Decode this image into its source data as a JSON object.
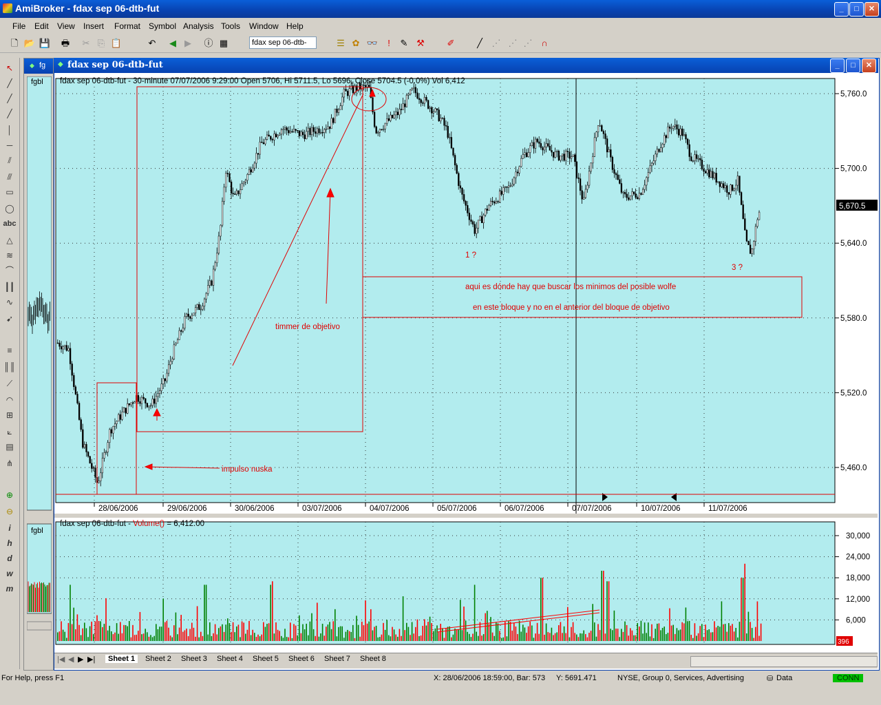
{
  "app": {
    "title": "AmiBroker - fdax sep 06-dtb-fut",
    "minimize": "_",
    "maximize": "□",
    "close": "✕"
  },
  "menu": [
    "File",
    "Edit",
    "View",
    "Insert",
    "Format",
    "Symbol",
    "Analysis",
    "Tools",
    "Window",
    "Help"
  ],
  "toolbar": {
    "symbol_select": "fdax sep 06-dtb-"
  },
  "child_window": {
    "title": "fdax sep 06-dtb-fut",
    "side_label": "fgbl",
    "side_tab": "fg"
  },
  "price_pane": {
    "header": "fdax sep 06-dtb-fut - 30-minute 07/07/2006 9:29:00 Open 5706, Hi 5711.5, Lo 5696, Close 5704.5 (-0.0%) Vol 6,412",
    "current_price_label": "5,670.5",
    "y_ticks": [
      "5,760.0",
      "5,700.0",
      "5,640.0",
      "5,580.0",
      "5,520.0",
      "5,460.0"
    ],
    "x_dates": [
      "28/06/2006",
      "29/06/2006",
      "30/06/2006",
      "03/07/2006",
      "04/07/2006",
      "05/07/2006",
      "06/07/2006",
      "07/07/2006",
      "10/07/2006",
      "11/07/2006"
    ],
    "annotations": {
      "impulse": "impulso    nuska",
      "timer": "timmer de objetivo",
      "one": "1 ?",
      "three": "3 ?",
      "box_line1": "aqui es dónde hay que buscar los minimos del posible wolfe",
      "box_line2": "en este bloque y no en el anterior del bloque  de objetivo"
    }
  },
  "volume_pane": {
    "header_prefix": "fdax sep 06-dtb-fut - ",
    "header_func": "Volume()",
    "header_suffix": " = 6,412.00",
    "y_ticks": [
      "30,000",
      "24,000",
      "18,000",
      "12,000",
      "6,000"
    ],
    "current_label": "396"
  },
  "sheets": [
    "Sheet 1",
    "Sheet 2",
    "Sheet 3",
    "Sheet 4",
    "Sheet 5",
    "Sheet 6",
    "Sheet 7",
    "Sheet 8"
  ],
  "status": {
    "help": "For Help, press F1",
    "coords": "X: 28/06/2006 18:59:00, Bar: 573",
    "yval": "Y: 5691.471",
    "exchange": "NYSE, Group 0, Services, Advertising",
    "data": "Data",
    "conn": "CONN"
  },
  "colors": {
    "chart_bg": "#b2ecee",
    "up": "#008000",
    "down": "#ff0000",
    "annot": "#e00000"
  }
}
